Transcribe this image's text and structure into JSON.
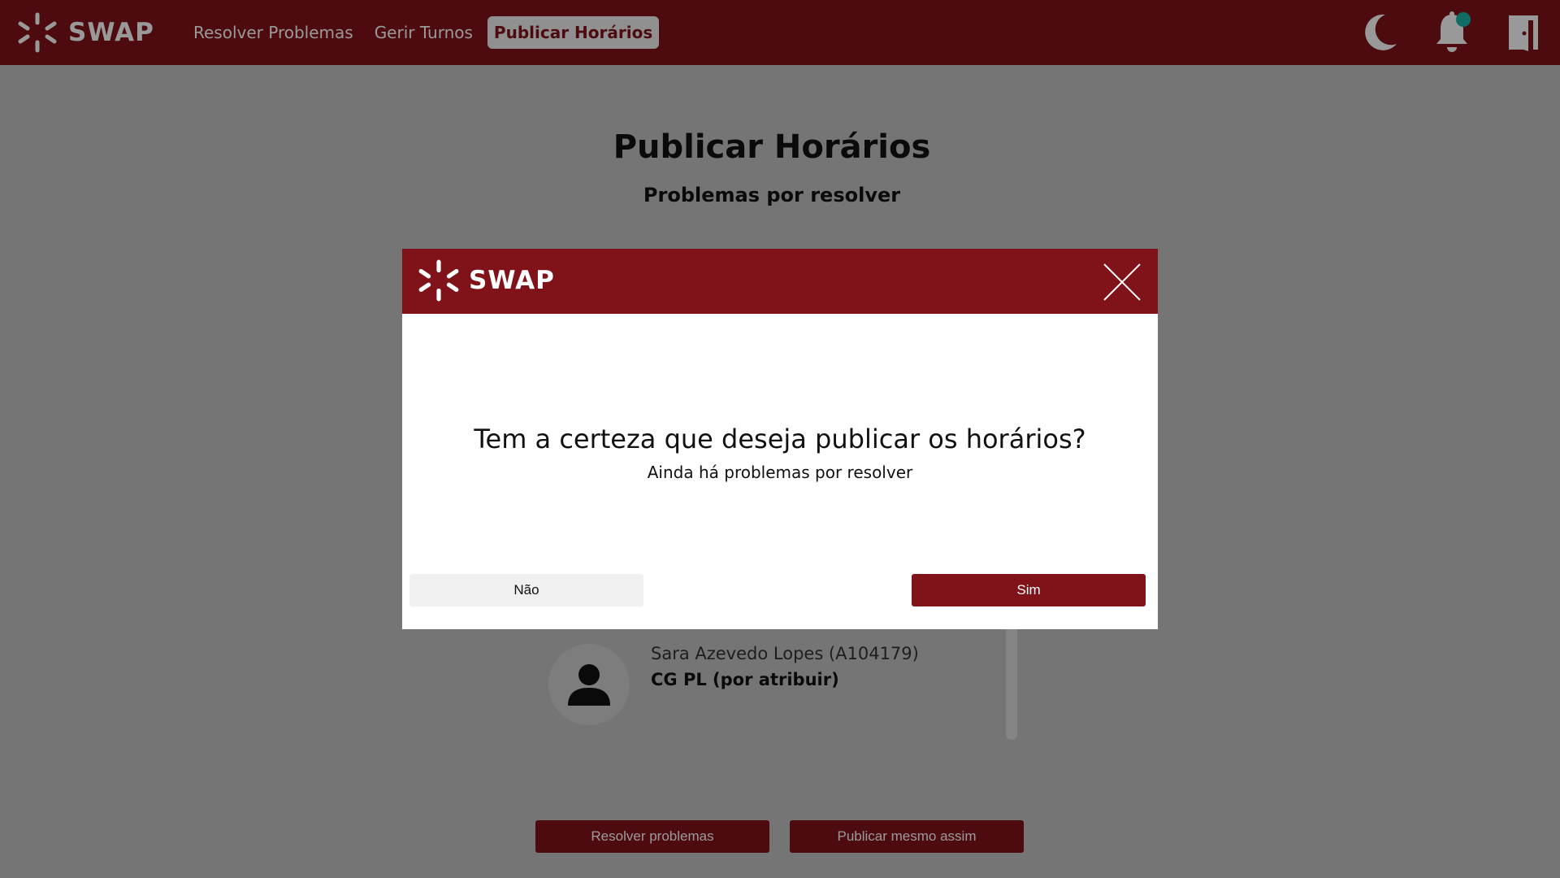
{
  "navbar": {
    "brand": "SWAP",
    "links": [
      "Resolver Problemas",
      "Gerir Turnos",
      "Publicar Horários"
    ],
    "active_link": "Publicar Horários",
    "icons": [
      "moon-icon",
      "bell-icon",
      "logout-door-icon"
    ]
  },
  "page": {
    "title": "Publicar Horários",
    "subtitle": "Problemas por resolver",
    "problem": {
      "name": "Sara Azevedo Lopes (A104179)",
      "description": "CG PL (por atribuir)"
    },
    "buttons": {
      "resolve": "Resolver problemas",
      "publish_anyway": "Publicar mesmo assim"
    }
  },
  "modal": {
    "brand": "SWAP",
    "question": "Tem a certeza que deseja publicar os horários?",
    "note": "Ainda há problemas por resolver",
    "no_label": "Não",
    "yes_label": "Sim"
  },
  "colors": {
    "brand": "#801319",
    "notification_dot": "#1bb5a8",
    "overlay": "rgba(0,0,0,0.4)"
  }
}
